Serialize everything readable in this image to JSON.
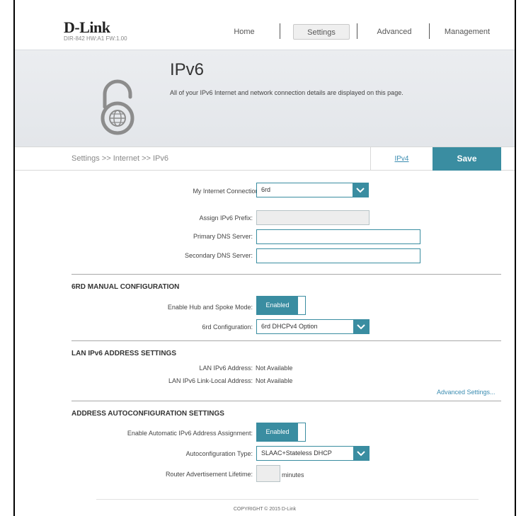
{
  "brand": {
    "logo": "D-Link",
    "model_info": "DIR-842   HW:A1   FW:1.00"
  },
  "nav": {
    "home": "Home",
    "settings": "Settings",
    "advanced": "Advanced",
    "management": "Management"
  },
  "hero": {
    "title": "IPv6",
    "description": "All of your IPv6 Internet and network connection details are displayed on this page.",
    "icon": "ipv6-lock-icon"
  },
  "breadcrumb": "Settings >> Internet >> IPv6",
  "tabs": {
    "ipv4": "IPv4",
    "save": "Save"
  },
  "connection": {
    "label": "My Internet Connection is:",
    "value": "6rd",
    "assign_prefix_label": "Assign IPv6 Prefix:",
    "assign_prefix_value": "",
    "primary_dns_label": "Primary DNS Server:",
    "primary_dns_value": "",
    "secondary_dns_label": "Secondary DNS Server:",
    "secondary_dns_value": ""
  },
  "sixrd": {
    "title": "6RD MANUAL CONFIGURATION",
    "hub_spoke_label": "Enable Hub and Spoke Mode:",
    "hub_spoke_value": "Enabled",
    "config_label": "6rd Configuration:",
    "config_value": "6rd DHCPv4 Option"
  },
  "lan": {
    "title": "LAN IPv6 ADDRESS SETTINGS",
    "address_label": "LAN IPv6 Address:",
    "address_value": "Not Available",
    "link_local_label": "LAN IPv6 Link-Local Address:",
    "link_local_value": "Not Available",
    "advanced_link": "Advanced Settings..."
  },
  "autoconfig": {
    "title": "ADDRESS AUTOCONFIGURATION SETTINGS",
    "enable_label": "Enable Automatic IPv6 Address Assignment:",
    "enable_value": "Enabled",
    "type_label": "Autoconfiguration Type:",
    "type_value": "SLAAC+Stateless DHCP",
    "lifetime_label": "Router Advertisement Lifetime:",
    "lifetime_value": "",
    "lifetime_unit": "minutes"
  },
  "footer": "COPYRIGHT © 2015 D-Link",
  "colors": {
    "accent": "#3a8da1",
    "link": "#3a8cb1"
  }
}
